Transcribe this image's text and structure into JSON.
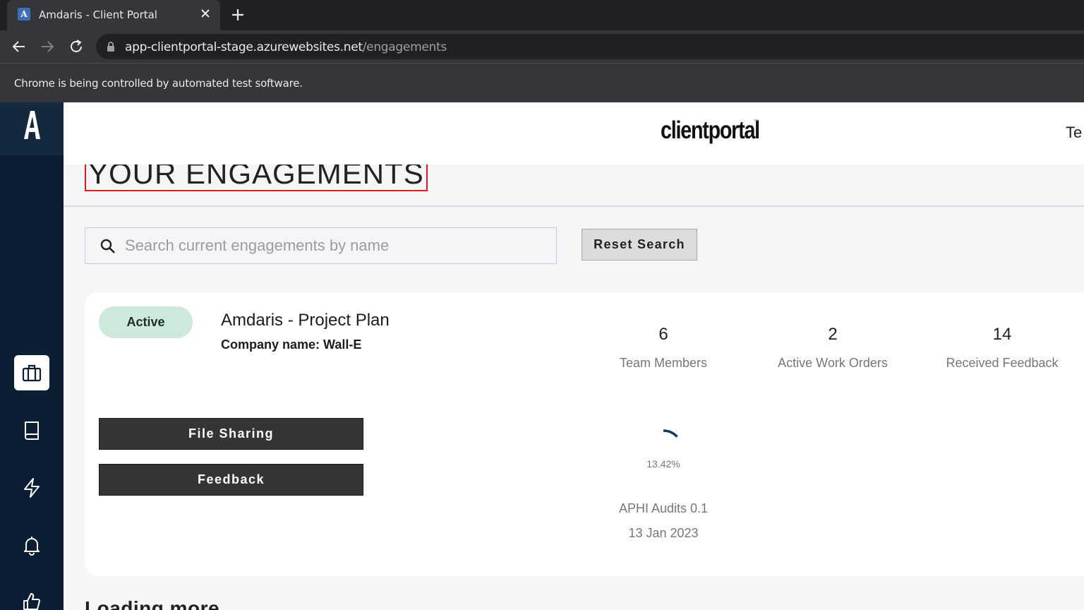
{
  "browser": {
    "tab_title": "Amdaris - Client Portal",
    "favicon_letter": "A",
    "url_host": "app-clientportal-stage.azurewebsites.net",
    "url_path": "/engagements",
    "infobar_text": "Chrome is being controlled by automated test software."
  },
  "header": {
    "brand": "clientportal",
    "brand_tm": "™",
    "user_text": "Te"
  },
  "page": {
    "title": "YOUR ENGAGEMENTS"
  },
  "search": {
    "placeholder": "Search current engagements by name",
    "value": "",
    "reset_label": "Reset Search"
  },
  "engagement": {
    "status": "Active",
    "name": "Amdaris - Project Plan",
    "company": "Company name: Wall-E",
    "stats": [
      {
        "value": "6",
        "label": "Team Members"
      },
      {
        "value": "2",
        "label": "Active Work Orders"
      },
      {
        "value": "14",
        "label": "Received Feedback"
      }
    ],
    "buttons": {
      "file_sharing": "File Sharing",
      "feedback": "Feedback"
    },
    "progress": {
      "percent_text": "13.42%",
      "value": 0.1342
    },
    "audit_name": "APHI Audits 0.1",
    "audit_date": "13 Jan 2023"
  },
  "footer": {
    "loading_text": "Loading more"
  },
  "sidebar": {
    "items": [
      {
        "icon": "briefcase-icon",
        "active": true
      },
      {
        "icon": "book-icon",
        "active": false
      },
      {
        "icon": "lightning-icon",
        "active": false
      },
      {
        "icon": "bell-icon",
        "active": false
      },
      {
        "icon": "thumbs-up-icon",
        "active": false
      }
    ]
  },
  "colors": {
    "sidebar_bg": "#0c1e33",
    "status_active_bg": "#cde9dc",
    "highlight_border": "#e01b1b",
    "progress_arc": "#123a63"
  }
}
